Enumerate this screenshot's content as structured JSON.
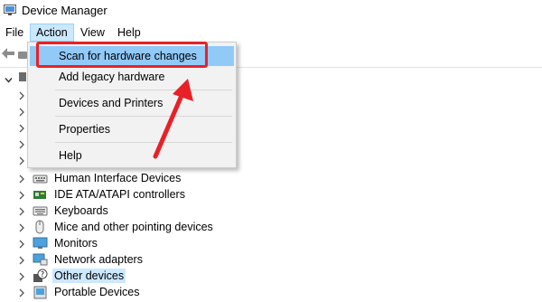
{
  "window": {
    "title": "Device Manager"
  },
  "menubar": {
    "items": [
      "File",
      "Action",
      "View",
      "Help"
    ]
  },
  "action_menu": {
    "items": [
      "Scan for hardware changes",
      "Add legacy hardware",
      "Devices and Printers",
      "Properties",
      "Help"
    ]
  },
  "tree": {
    "rows": [
      "Human Interface Devices",
      "IDE ATA/ATAPI controllers",
      "Keyboards",
      "Mice and other pointing devices",
      "Monitors",
      "Network adapters",
      "Other devices",
      "Portable Devices"
    ],
    "selected": "Other devices"
  },
  "colors": {
    "menu_highlight": "#91c9f7",
    "selection": "#cce8ff",
    "annotation": "#ea2027"
  }
}
